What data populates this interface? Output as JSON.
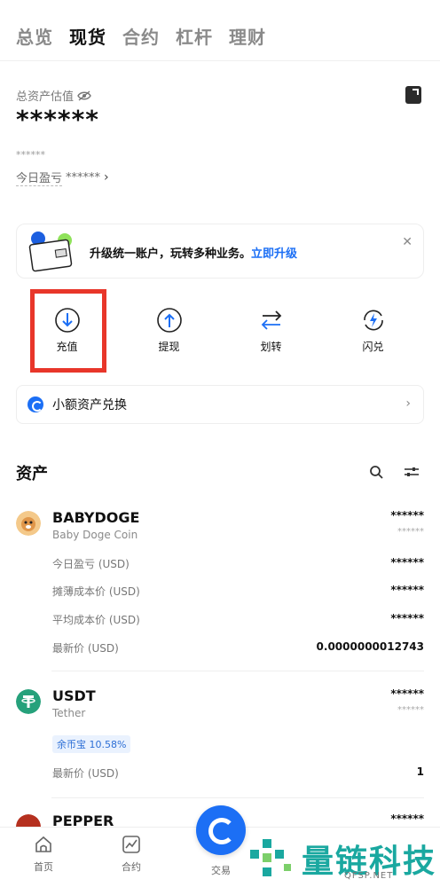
{
  "tabs": [
    "总览",
    "现货",
    "合约",
    "杠杆",
    "理财"
  ],
  "active_tab": 1,
  "total": {
    "label": "总资产估值",
    "value": "******",
    "sub_value": "******",
    "today_label": "今日盈亏",
    "today_value": "******"
  },
  "banner": {
    "text": "升级统一账户，玩转多种业务。",
    "link": "立即升级"
  },
  "actions": [
    {
      "label": "充值",
      "icon": "deposit-icon"
    },
    {
      "label": "提现",
      "icon": "withdraw-icon"
    },
    {
      "label": "划转",
      "icon": "transfer-icon"
    },
    {
      "label": "闪兑",
      "icon": "flash-swap-icon"
    }
  ],
  "small_swap": {
    "label": "小额资产兑换"
  },
  "assets": {
    "title": "资产",
    "items": [
      {
        "symbol": "BABYDOGE",
        "name": "Baby Doge Coin",
        "amount": "******",
        "amount_sub": "******",
        "rows": [
          {
            "label": "今日盈亏 (USD)",
            "value": "******"
          },
          {
            "label": "摊薄成本价 (USD)",
            "value": "******"
          },
          {
            "label": "平均成本价 (USD)",
            "value": "******"
          },
          {
            "label": "最新价 (USD)",
            "value": "0.0000000012743"
          }
        ]
      },
      {
        "symbol": "USDT",
        "name": "Tether",
        "amount": "******",
        "amount_sub": "******",
        "badge": "余币宝 10.58%",
        "rows": [
          {
            "label": "最新价 (USD)",
            "value": "1"
          }
        ]
      },
      {
        "symbol": "PEPPER",
        "amount": "******"
      }
    ]
  },
  "bottom_nav": [
    {
      "label": "首页",
      "icon": "home-icon"
    },
    {
      "label": "合约",
      "icon": "chart-icon"
    },
    {
      "label": "交易",
      "icon": "trade-icon"
    }
  ],
  "watermark": {
    "text": "量链科技",
    "sub": "QFSP.NET"
  },
  "colors": {
    "accent": "#1c6ff5",
    "highlight": "#e8362a",
    "watermark": "#1aa8a0"
  }
}
